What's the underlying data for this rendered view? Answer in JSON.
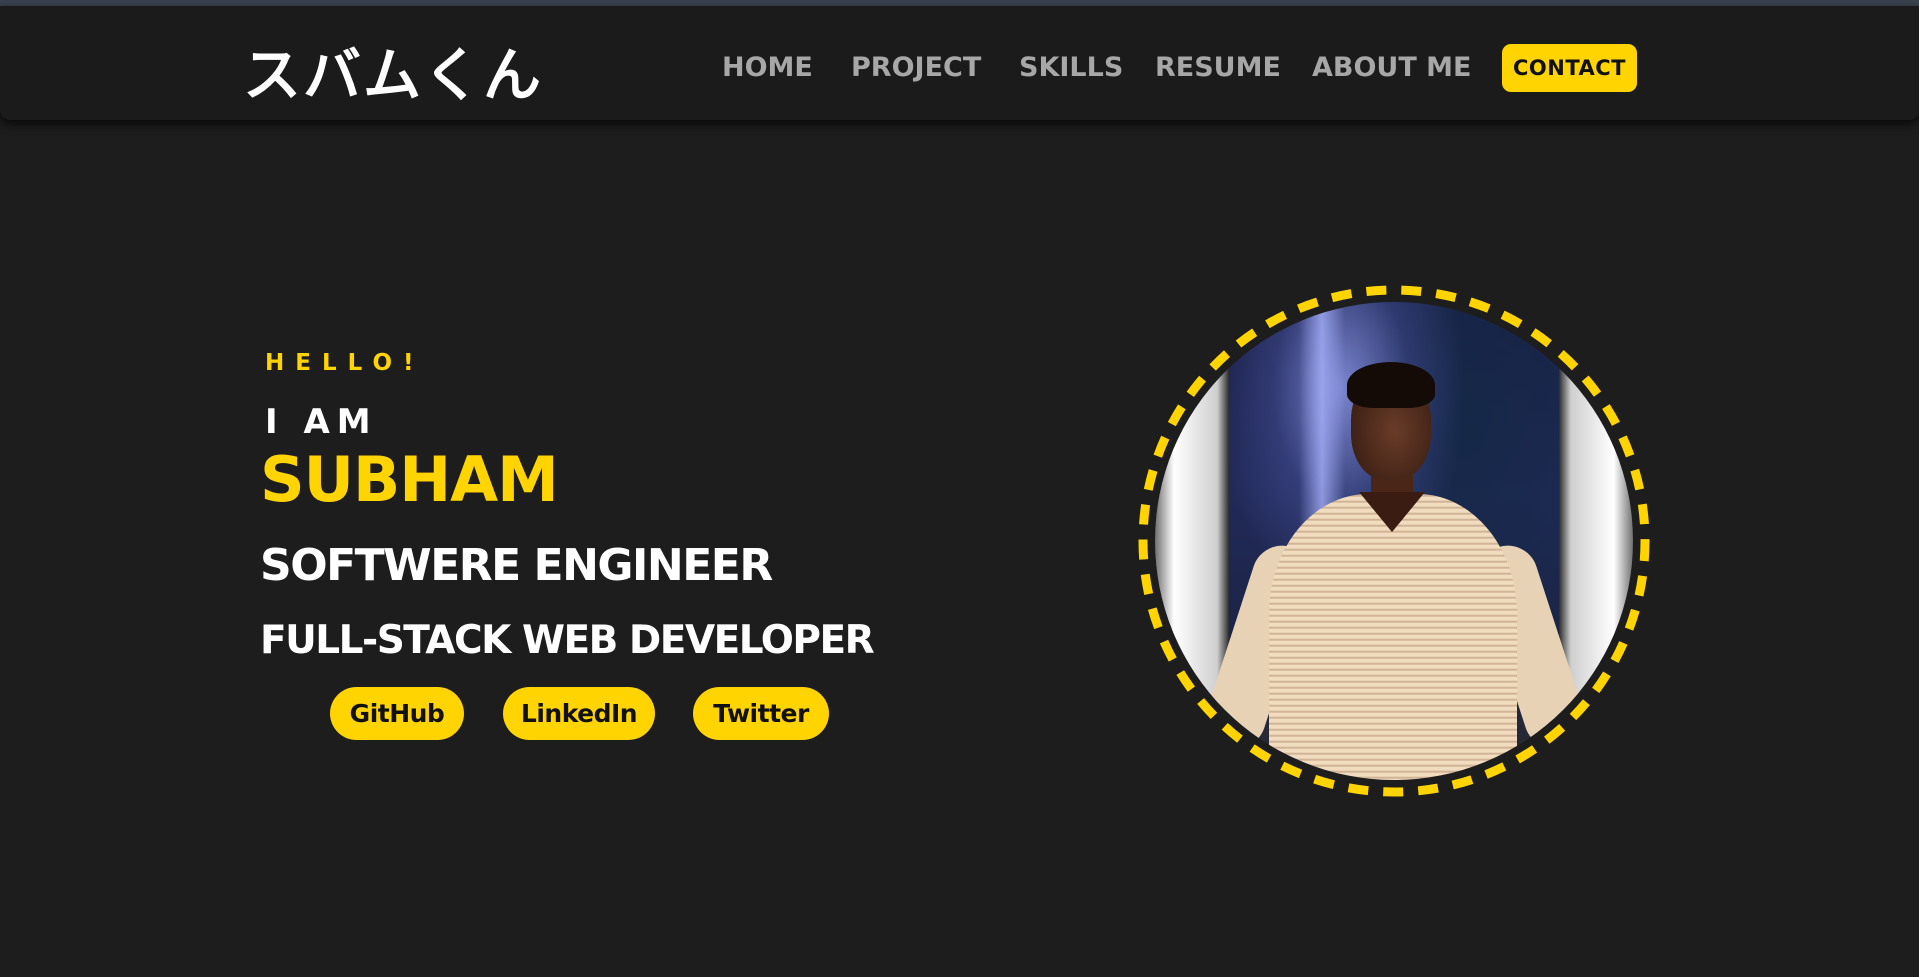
{
  "header": {
    "logo": "スバムくん",
    "nav": [
      "HOME",
      "PROJECT",
      "SKILLS",
      "RESUME",
      "ABOUT ME"
    ],
    "contact_label": "CONTACT"
  },
  "hero": {
    "greeting": "HELLO!",
    "intro": "I AM",
    "name": "SUBHAM",
    "role_primary": "SOFTWERE ENGINEER",
    "role_secondary": "FULL-STACK WEB DEVELOPER",
    "social": [
      "GitHub",
      "LinkedIn",
      "Twitter"
    ]
  },
  "colors": {
    "accent": "#ffd400",
    "background": "#1d1d1d",
    "header_bg": "#1b1b1b",
    "nav_text": "#a7a7a7",
    "heading_text": "#ffffff"
  },
  "icons": {
    "avatar_ring": "dashed-circle-border"
  }
}
